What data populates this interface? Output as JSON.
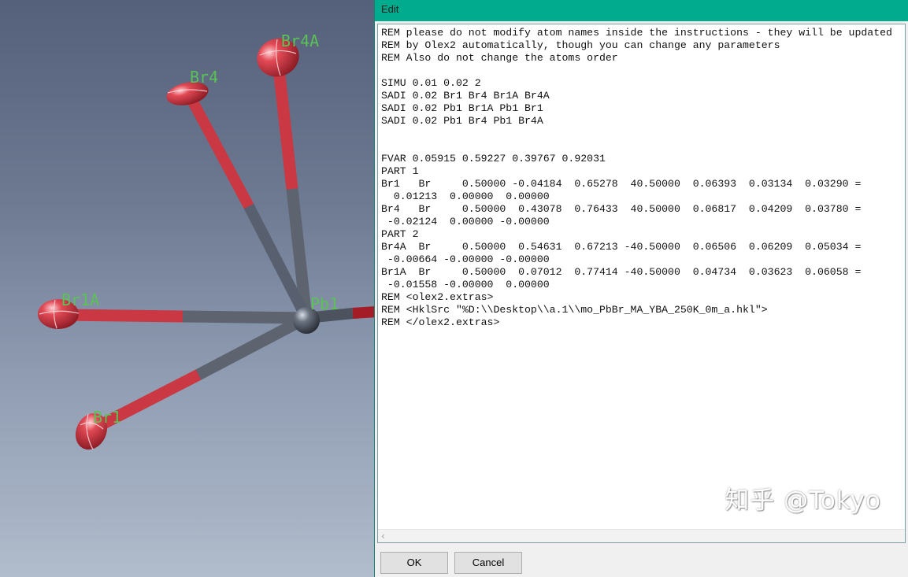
{
  "viewer": {
    "atoms": [
      {
        "name": "Br4A"
      },
      {
        "name": "Br4"
      },
      {
        "name": "Br1A"
      },
      {
        "name": "Pb1"
      },
      {
        "name": "Br1"
      }
    ],
    "colors": {
      "bromine": "#c8323c",
      "lead": "#5a6068",
      "label": "#5bc256"
    }
  },
  "edit": {
    "title": "Edit",
    "lines": [
      "REM please do not modify atom names inside the instructions - they will be updated",
      "REM by Olex2 automatically, though you can change any parameters",
      "REM Also do not change the atoms order",
      "",
      "SIMU 0.01 0.02 2",
      "SADI 0.02 Br1 Br4 Br1A Br4A",
      "SADI 0.02 Pb1 Br1A Pb1 Br1",
      "SADI 0.02 Pb1 Br4 Pb1 Br4A",
      "",
      "",
      "FVAR 0.05915 0.59227 0.39767 0.92031",
      "PART 1",
      "Br1   Br     0.50000 -0.04184  0.65278  40.50000  0.06393  0.03134  0.03290 =",
      "  0.01213  0.00000  0.00000",
      "Br4   Br     0.50000  0.43078  0.76433  40.50000  0.06817  0.04209  0.03780 =",
      " -0.02124  0.00000 -0.00000",
      "PART 2",
      "Br4A  Br     0.50000  0.54631  0.67213 -40.50000  0.06506  0.06209  0.05034 =",
      " -0.00664 -0.00000 -0.00000",
      "Br1A  Br     0.50000  0.07012  0.77414 -40.50000  0.04734  0.03623  0.06058 =",
      " -0.01558 -0.00000  0.00000",
      "REM <olex2.extras>",
      "REM <HklSrc \"%D:\\\\Desktop\\\\a.1\\\\mo_PbBr_MA_YBA_250K_0m_a.hkl\">",
      "REM </olex2.extras>"
    ],
    "scroll_left_icon": "‹",
    "ok_label": "OK",
    "cancel_label": "Cancel",
    "watermark": "知乎 @Tokyo"
  }
}
